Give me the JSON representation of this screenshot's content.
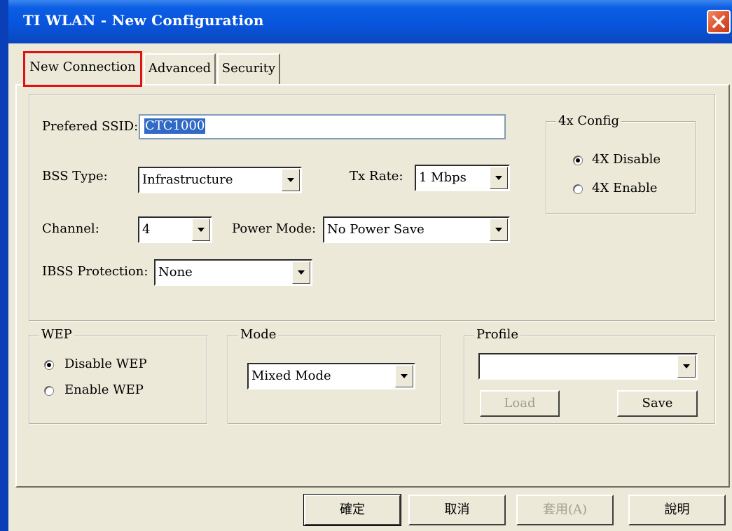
{
  "window": {
    "title": "TI WLAN - New Configuration"
  },
  "tabs": [
    {
      "label": "New Connection",
      "active": true
    },
    {
      "label": "Advanced",
      "active": false
    },
    {
      "label": "Security",
      "active": false
    }
  ],
  "connection": {
    "ssid_label": "Prefered SSID:",
    "ssid_value": "CTC1000",
    "bss_type_label": "BSS Type:",
    "bss_type_value": "Infrastructure",
    "tx_rate_label": "Tx Rate:",
    "tx_rate_value": "1 Mbps",
    "channel_label": "Channel:",
    "channel_value": "4",
    "power_mode_label": "Power Mode:",
    "power_mode_value": "No Power Save",
    "ibss_label": "IBSS Protection:",
    "ibss_value": "None"
  },
  "config4x": {
    "title": "4x Config",
    "options": [
      {
        "label": "4X Disable",
        "selected": true
      },
      {
        "label": "4X Enable",
        "selected": false
      }
    ]
  },
  "wep": {
    "title": "WEP",
    "options": [
      {
        "label": "Disable WEP",
        "selected": true
      },
      {
        "label": "Enable WEP",
        "selected": false
      }
    ]
  },
  "mode": {
    "title": "Mode",
    "value": "Mixed Mode"
  },
  "profile": {
    "title": "Profile",
    "value": "",
    "load_label": "Load",
    "load_enabled": false,
    "save_label": "Save"
  },
  "footer": {
    "ok_label": "確定",
    "cancel_label": "取消",
    "apply_label": "套用(A)",
    "apply_enabled": false,
    "help_label": "說明"
  },
  "icons": {
    "close": "close-icon",
    "dropdown": "chevron-down-icon"
  },
  "colors": {
    "titlebar": "#0855dd",
    "window_bg": "#ece9d8",
    "selection": "#316ac5",
    "highlight_box": "#e01212",
    "close_button": "#e15a33"
  }
}
